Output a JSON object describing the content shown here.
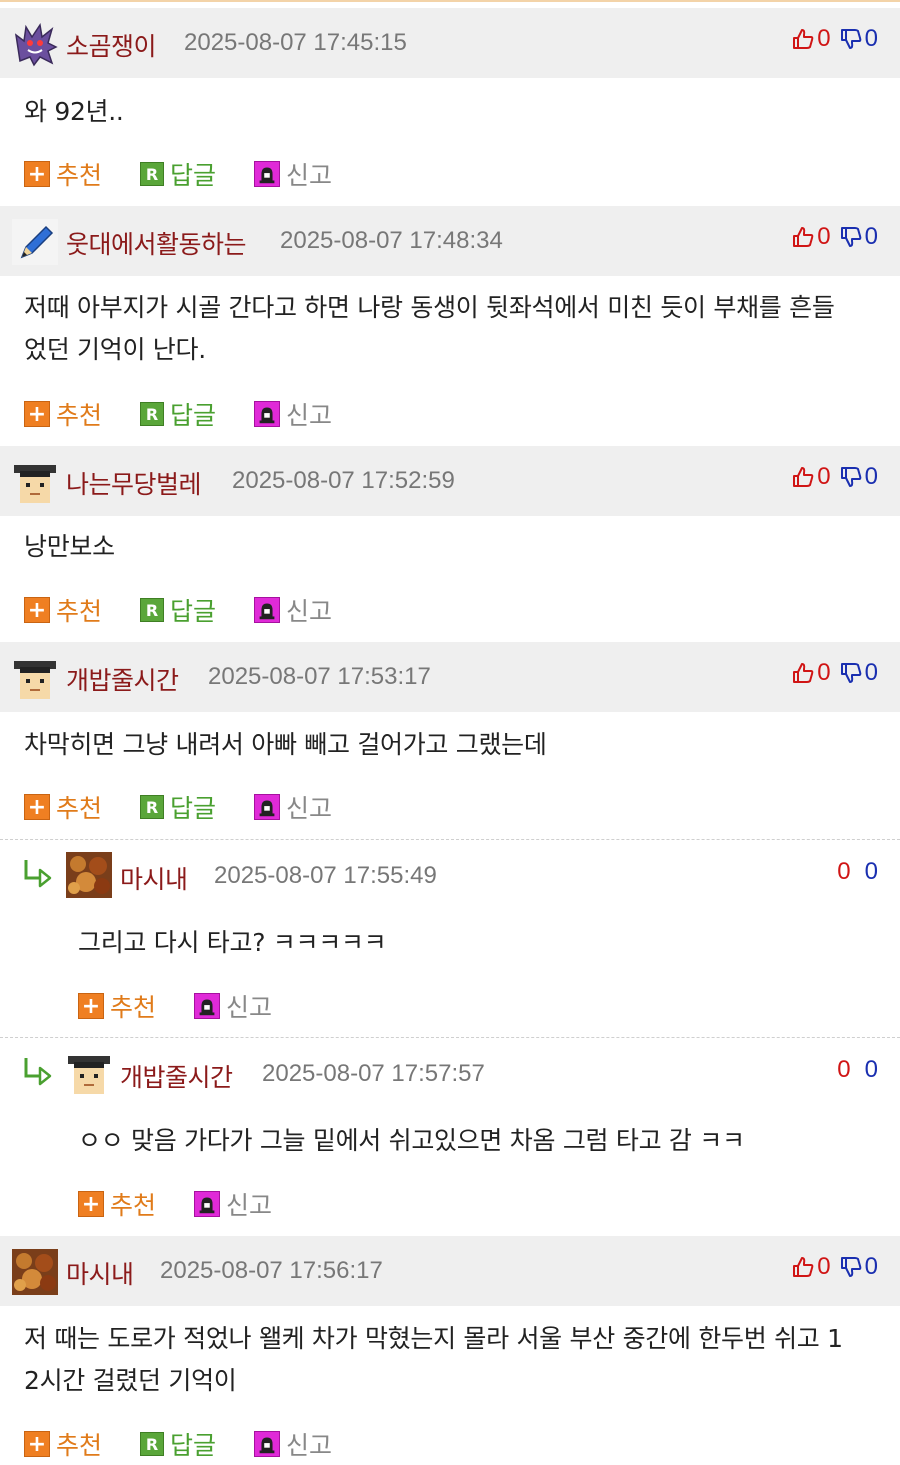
{
  "colors": {
    "header_bg": "#efefef",
    "nickname": "#8b1a1a",
    "date": "#777777",
    "upvote": "#d01515",
    "downvote": "#1a2fb0",
    "recommend": "#e07b1a",
    "reply": "#4aa030",
    "report": "#888888"
  },
  "labels": {
    "recommend": "추천",
    "reply": "답글",
    "report": "신고"
  },
  "comments": [
    {
      "nickname": "소곰쟁이",
      "date": "2025-08-07 17:45:15",
      "up": "0",
      "down": "0",
      "lines": [
        "와 92년.."
      ],
      "avatar": "ghost-avatar"
    },
    {
      "nickname": "웃대에서활동하는",
      "date": "2025-08-07 17:48:34",
      "up": "0",
      "down": "0",
      "lines": [
        "저때 아부지가 시골 간다고 하면 나랑 동생이 뒷좌석에서 미친 듯이 부채를 흔들",
        "었던 기억이 난다."
      ],
      "avatar": "pencil-avatar"
    },
    {
      "nickname": "나는무당벌레",
      "date": "2025-08-07 17:52:59",
      "up": "0",
      "down": "0",
      "lines": [
        "낭만보소"
      ],
      "avatar": "graduate-avatar"
    },
    {
      "nickname": "개밥줄시간",
      "date": "2025-08-07 17:53:17",
      "up": "0",
      "down": "0",
      "lines": [
        "차막히면 그냥 내려서 아빠 빼고 걸어가고 그랬는데"
      ],
      "avatar": "graduate-avatar"
    },
    {
      "nickname": "마시내",
      "date": "2025-08-07 17:56:17",
      "up": "0",
      "down": "0",
      "lines": [
        "저 때는 도로가 적었나 왤케 차가 막혔는지 몰라 서울 부산 중간에 한두번 쉬고 1",
        "2시간 걸렸던 기억이"
      ],
      "avatar": "food-avatar"
    }
  ],
  "replies": [
    {
      "nickname": "마시내",
      "date": "2025-08-07 17:55:49",
      "up": "0",
      "down": "0",
      "text": "그리고 다시 타고? ㅋㅋㅋㅋㅋ",
      "avatar": "food-avatar"
    },
    {
      "nickname": "개밥줄시간",
      "date": "2025-08-07 17:57:57",
      "up": "0",
      "down": "0",
      "text": "ㅇㅇ 맞음 가다가 그늘 밑에서 쉬고있으면 차옴 그럼 타고 감 ㅋㅋ",
      "avatar": "graduate-avatar"
    }
  ]
}
